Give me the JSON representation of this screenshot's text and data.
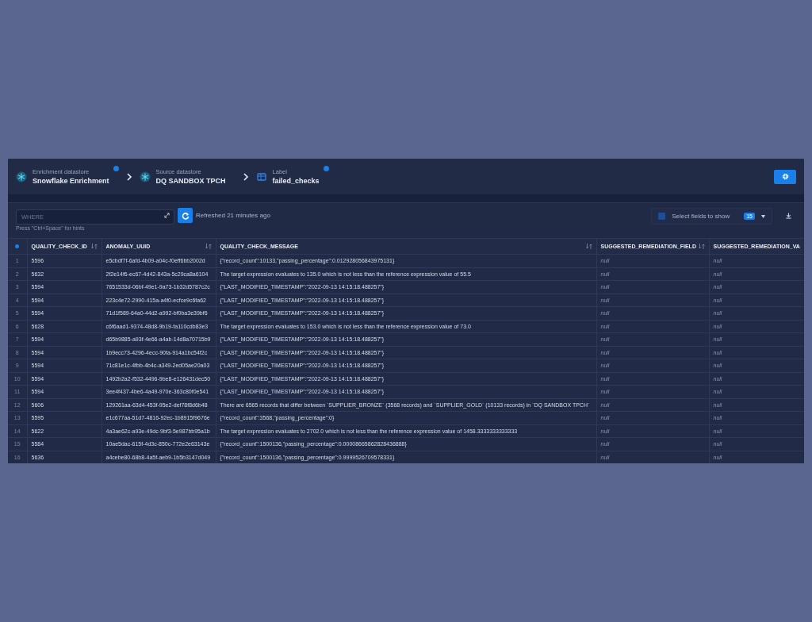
{
  "breadcrumbs": [
    {
      "kind": "datastore",
      "label": "Enrichment datastore",
      "value": "Snowflake Enrichment",
      "badge": true
    },
    {
      "kind": "datastore",
      "label": "Source datastore",
      "value": "DQ SANDBOX TPCH",
      "badge": false
    },
    {
      "kind": "table",
      "label": "Label",
      "value": "failed_checks",
      "badge": true
    }
  ],
  "toolbar": {
    "query_placeholder": "WHERE",
    "hint": "Press \"Ctrl+Space\" for hints",
    "refreshed": "Refreshed 21 minutes ago",
    "field_selector": "Select fields to show",
    "fields_checked": true,
    "field_count": "15"
  },
  "table": {
    "columns": [
      {
        "title": "QUALITY_CHECK_ID",
        "sortable": true,
        "kind": "text"
      },
      {
        "title": "ANOMALY_UUID",
        "sortable": true,
        "kind": "text"
      },
      {
        "title": "QUALITY_CHECK_MESSAGE",
        "sortable": true,
        "kind": "text"
      },
      {
        "title": "SUGGESTED_REMEDIATION_FIELD",
        "sortable": true,
        "kind": "nullable"
      },
      {
        "title": "SUGGESTED_REMEDIATION_VA",
        "sortable": false,
        "kind": "nullable"
      }
    ],
    "rows": [
      {
        "number": "1",
        "cells": [
          "5596",
          "e5cbdf7f-6afd-4b09-a04c-f0eff6bb2002d",
          "{\"record_count\":10133,\"passing_percentage\":0.012928056843975131}",
          "null",
          "null"
        ]
      },
      {
        "number": "2",
        "cells": [
          "5632",
          "2f2e14f6-ec67-4d42-843a-5c29ca8a6104",
          "The target expression evaluates to 135.0 which is not less than the reference expression value of 55.5",
          "null",
          "null"
        ]
      },
      {
        "number": "3",
        "cells": [
          "5594",
          "7651533d-06bf-49e1-9a73-1b32d5787c2c",
          "{\"LAST_MODIFIED_TIMESTAMP\":\"2022-09-13 14:15:18.488257\"}",
          "null",
          "null"
        ]
      },
      {
        "number": "4",
        "cells": [
          "5594",
          "223c4e72-2990-415a-a4f0-ecfce9c6fa62",
          "{\"LAST_MODIFIED_TIMESTAMP\":\"2022-09-13 14:15:18.488257\"}",
          "null",
          "null"
        ]
      },
      {
        "number": "5",
        "cells": [
          "5594",
          "71d1f589-64a0-44d2-a992-bf0ba3e39bf6",
          "{\"LAST_MODIFIED_TIMESTAMP\":\"2022-09-13 14:15:18.488257\"}",
          "null",
          "null"
        ]
      },
      {
        "number": "6",
        "cells": [
          "5628",
          "c6f6aad1-9374-48d8-9b19-fa110cdb83e3",
          "The target expression evaluates to 153.0 which is not less than the reference expression value of 73.0",
          "null",
          "null"
        ]
      },
      {
        "number": "7",
        "cells": [
          "5594",
          "d65b9885-a93f-4e66-a4ab-14d8a70715b9",
          "{\"LAST_MODIFIED_TIMESTAMP\":\"2022-09-13 14:15:18.488257\"}",
          "null",
          "null"
        ]
      },
      {
        "number": "8",
        "cells": [
          "5594",
          "1b9ecc73-4296-4ecc-90fa-914a1bc54f2c",
          "{\"LAST_MODIFIED_TIMESTAMP\":\"2022-09-13 14:15:18.488257\"}",
          "null",
          "null"
        ]
      },
      {
        "number": "9",
        "cells": [
          "5594",
          "71c81e1c-4fbb-4b4c-a349-2ed05ae20a03",
          "{\"LAST_MODIFIED_TIMESTAMP\":\"2022-09-13 14:15:18.488257\"}",
          "null",
          "null"
        ]
      },
      {
        "number": "10",
        "cells": [
          "5594",
          "1492b2a2-f532-4496-9be8-e126431dec50",
          "{\"LAST_MODIFIED_TIMESTAMP\":\"2022-09-13 14:15:18.488257\"}",
          "null",
          "null"
        ]
      },
      {
        "number": "11",
        "cells": [
          "5594",
          "3ee4f437-4be6-4a49-970e-363c80f0e541",
          "{\"LAST_MODIFIED_TIMESTAMP\":\"2022-09-13 14:15:18.488257\"}",
          "null",
          "null"
        ]
      },
      {
        "number": "12",
        "cells": [
          "5606",
          "129261aa-63d4-453f-95e2-def78f8d6b48",
          "There are 6565 records that differ between `SUPPLIER_BRONZE` (3568 records) and `SUPPLIER_GOLD` (10133 records) in `DQ SANDBOX TPCH`",
          "null",
          "null"
        ]
      },
      {
        "number": "13",
        "cells": [
          "5595",
          "e1c677aa-51d7-4816-92ec-1b8915f9676e",
          "{\"record_count\":3568,\"passing_percentage\":0}",
          "null",
          "null"
        ]
      },
      {
        "number": "14",
        "cells": [
          "5622",
          "4a3ae62c-a93e-49dc-9bf3-5e987bb95a1b",
          "The target expression evaluates to 2702.0 which is not less than the reference expression value of 1458.3333333333333",
          "null",
          "null"
        ]
      },
      {
        "number": "15",
        "cells": [
          "5584",
          "10ae5dac-615f-4d3c-850c-772e2e63143e",
          "{\"record_count\":1500136,\"passing_percentage\":0.00008665862828436888}",
          "null",
          "null"
        ]
      },
      {
        "number": "16",
        "cells": [
          "5636",
          "a4cebe80-68b8-4a5f-aeb9-1b5b3147d049",
          "{\"record_count\":1500136,\"passing_percentage\":0.9999526709578331}",
          "null",
          "null"
        ]
      }
    ]
  }
}
